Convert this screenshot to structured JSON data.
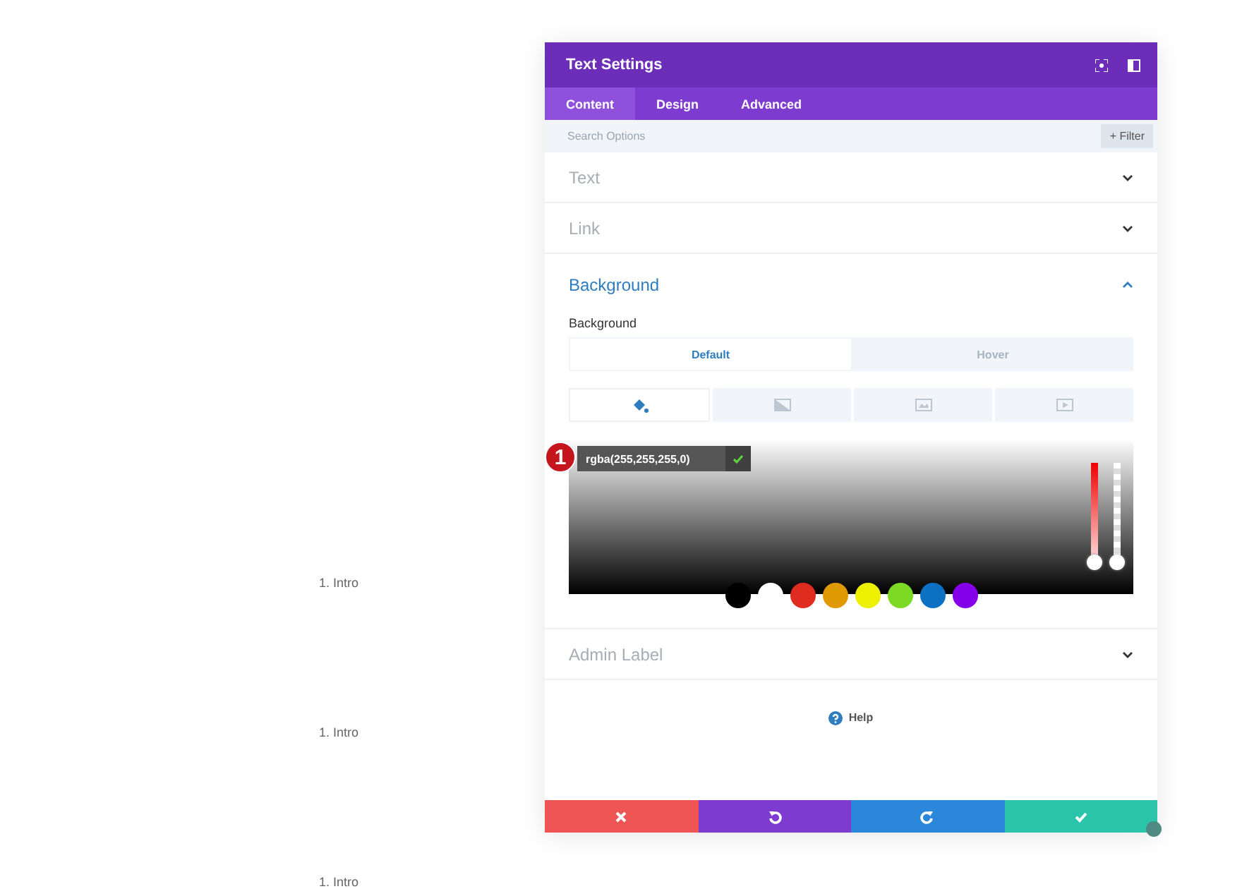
{
  "outline_labels": [
    "1. Intro",
    "1. Intro",
    "1. Intro"
  ],
  "panel": {
    "title": "Text Settings",
    "tabs": [
      {
        "label": "Content",
        "selected": true
      },
      {
        "label": "Design",
        "selected": false
      },
      {
        "label": "Advanced",
        "selected": false
      }
    ],
    "search": {
      "placeholder": "Search Options"
    },
    "filter_button": "+ Filter",
    "sections": [
      {
        "title": "Text",
        "expanded": false
      },
      {
        "title": "Link",
        "expanded": false
      },
      {
        "title": "Background",
        "expanded": true
      },
      {
        "title": "Admin Label",
        "expanded": false
      }
    ],
    "background": {
      "label": "Background",
      "mode_tabs": [
        {
          "label": "Default",
          "selected": true
        },
        {
          "label": "Hover",
          "selected": false
        }
      ],
      "type_tabs": [
        {
          "kind": "color",
          "selected": true
        },
        {
          "kind": "gradient",
          "selected": false
        },
        {
          "kind": "image",
          "selected": false
        },
        {
          "kind": "video",
          "selected": false
        }
      ],
      "step_badge": "1",
      "color_value": "rgba(255,255,255,0)",
      "sliders": [
        {
          "kind": "hue",
          "level": 0
        },
        {
          "kind": "alpha",
          "level": 0
        }
      ],
      "swatches": [
        {
          "color": "#000000"
        },
        {
          "color": "#ffffff"
        },
        {
          "color": "#e02b20"
        },
        {
          "color": "#e09900"
        },
        {
          "color": "#edf000"
        },
        {
          "color": "#7cda24"
        },
        {
          "color": "#0c71c3"
        },
        {
          "color": "#8300e9"
        }
      ]
    },
    "help": "Help",
    "actions": [
      {
        "kind": "discard"
      },
      {
        "kind": "undo"
      },
      {
        "kind": "redo"
      },
      {
        "kind": "save"
      }
    ]
  }
}
